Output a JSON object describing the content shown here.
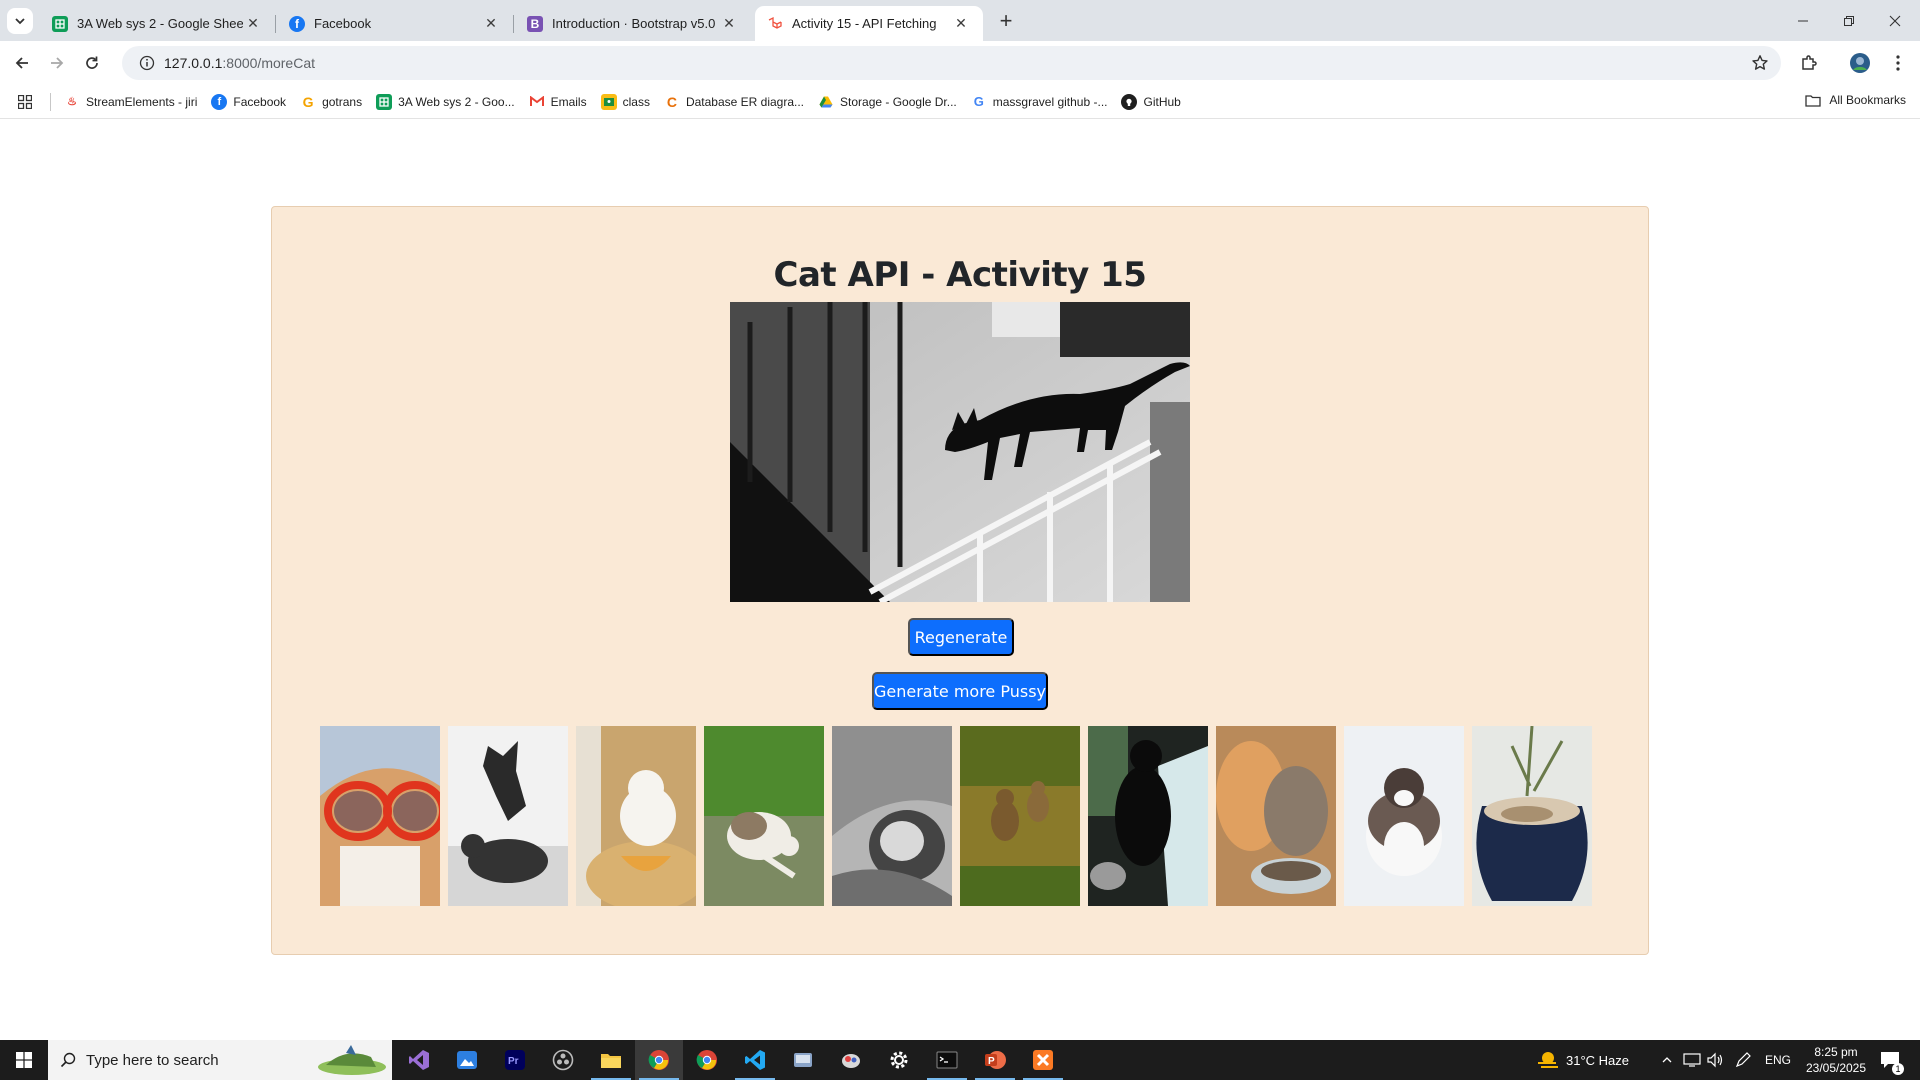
{
  "browser": {
    "tabs": [
      {
        "title": "3A Web sys 2 - Google Sheets",
        "favicon": "google-sheets-icon",
        "active": false
      },
      {
        "title": "Facebook",
        "favicon": "facebook-icon",
        "active": false
      },
      {
        "title": "Introduction · Bootstrap v5.0",
        "favicon": "bootstrap-icon",
        "active": false
      },
      {
        "title": "Activity 15 - API Fetching",
        "favicon": "laravel-icon",
        "active": true
      }
    ],
    "url_host": "127.0.0.1",
    "url_rest": ":8000/moreCat",
    "bookmarks": [
      {
        "label": "StreamElements - jiri",
        "icon": "streamelements-icon"
      },
      {
        "label": "Facebook",
        "icon": "facebook-icon"
      },
      {
        "label": "gotrans",
        "icon": "gotrans-icon"
      },
      {
        "label": "3A Web sys 2 - Goo...",
        "icon": "google-sheets-icon"
      },
      {
        "label": "Emails",
        "icon": "gmail-icon"
      },
      {
        "label": "class",
        "icon": "classroom-icon"
      },
      {
        "label": "Database ER diagra...",
        "icon": "drawsql-icon"
      },
      {
        "label": "Storage - Google Dr...",
        "icon": "google-drive-icon"
      },
      {
        "label": "massgravel github -...",
        "icon": "google-icon"
      },
      {
        "label": "GitHub",
        "icon": "github-icon"
      }
    ],
    "all_bookmarks_label": "All Bookmarks"
  },
  "page": {
    "title": "Cat API - Activity 15",
    "regenerate_label": "Regenerate",
    "more_label": "Generate more Pussy",
    "thumbnail_count": 10
  },
  "taskbar": {
    "search_placeholder": "Type here to search",
    "weather": "31°C  Haze",
    "language": "ENG",
    "time": "8:25 pm",
    "date": "23/05/2025",
    "notifications": "1"
  },
  "colors": {
    "card_bg": "#fae9d6",
    "button_primary": "#0d6efd",
    "taskbar_bg": "#1c1c1c"
  }
}
